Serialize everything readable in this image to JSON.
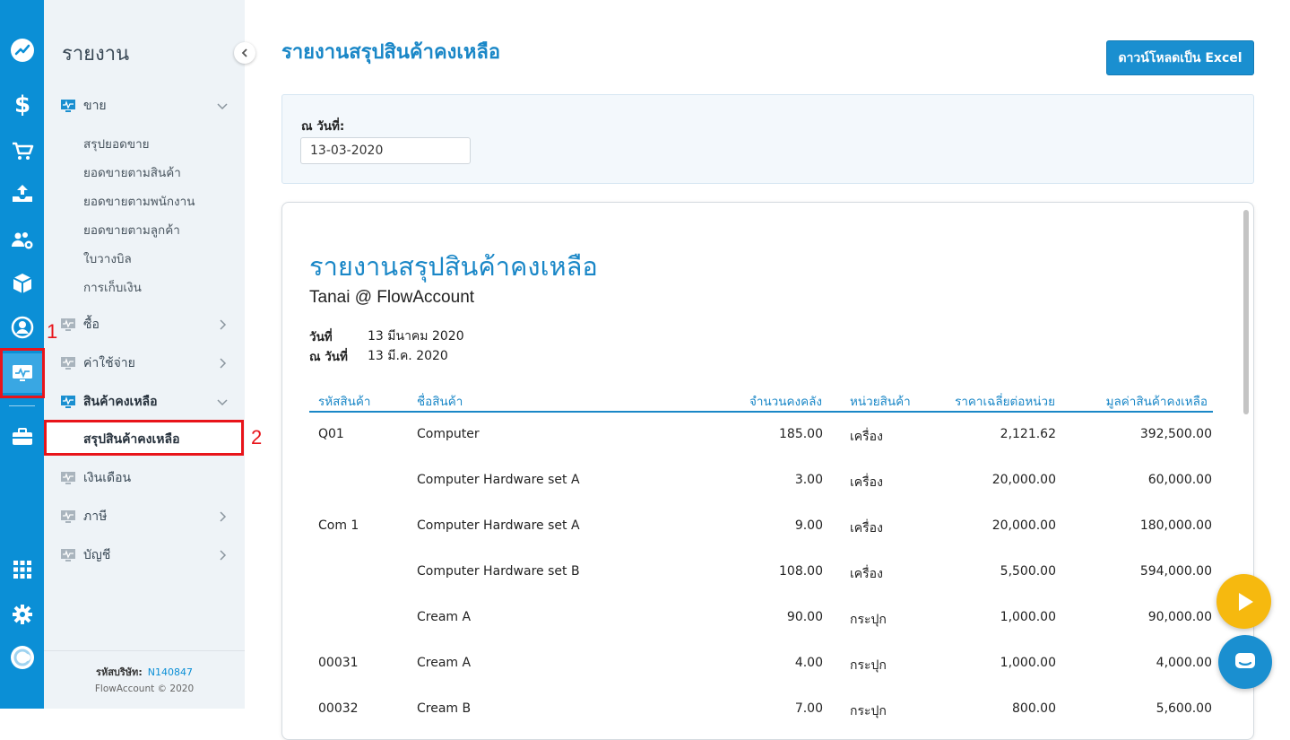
{
  "sidebar": {
    "title": "รายงาน",
    "sections": [
      {
        "label": "ขาย",
        "expanded": true,
        "items": [
          "สรุปยอดขาย",
          "ยอดขายตามสินค้า",
          "ยอดขายตามพนักงาน",
          "ยอดขายตามลูกค้า",
          "ใบวางบิล",
          "การเก็บเงิน"
        ]
      },
      {
        "label": "ซื้อ"
      },
      {
        "label": "ค่าใช้จ่าย"
      },
      {
        "label": "สินค้าคงเหลือ",
        "expanded": true,
        "items": [
          "สรุปสินค้าคงเหลือ"
        ]
      },
      {
        "label": "เงินเดือน"
      },
      {
        "label": "ภาษี"
      },
      {
        "label": "บัญชี"
      }
    ],
    "company_label": "รหัสบริษัท:",
    "company_id": "N140847",
    "copyright": "FlowAccount © 2020"
  },
  "annotations": {
    "one": "1",
    "two": "2"
  },
  "main": {
    "title": "รายงานสรุปสินค้าคงเหลือ",
    "download_button": "ดาวน์โหลดเป็น Excel",
    "filter_label": "ณ วันที่:",
    "date_value": "13-03-2020"
  },
  "report": {
    "title": "รายงานสรุปสินค้าคงเหลือ",
    "company": "Tanai @ FlowAccount",
    "date_label": "วันที่",
    "date_value": "13 มีนาคม 2020",
    "asof_label": "ณ วันที่",
    "asof_value": "13 มี.ค. 2020",
    "columns": [
      "รหัสสินค้า",
      "ชื่อสินค้า",
      "จำนวนคงคลัง",
      "หน่วยสินค้า",
      "ราคาเฉลี่ยต่อหน่วย",
      "มูลค่าสินค้าคงเหลือ"
    ],
    "rows": [
      [
        "Q01",
        "Computer",
        "185.00",
        "เครื่อง",
        "2,121.62",
        "392,500.00"
      ],
      [
        "",
        "Computer Hardware set A",
        "3.00",
        "เครื่อง",
        "20,000.00",
        "60,000.00"
      ],
      [
        "Com 1",
        "Computer Hardware set A",
        "9.00",
        "เครื่อง",
        "20,000.00",
        "180,000.00"
      ],
      [
        "",
        "Computer Hardware set B",
        "108.00",
        "เครื่อง",
        "5,500.00",
        "594,000.00"
      ],
      [
        "",
        "Cream A",
        "90.00",
        "กระปุก",
        "1,000.00",
        "90,000.00"
      ],
      [
        "00031",
        "Cream A",
        "4.00",
        "กระปุก",
        "1,000.00",
        "4,000.00"
      ],
      [
        "00032",
        "Cream B",
        "7.00",
        "กระปุก",
        "800.00",
        "5,600.00"
      ]
    ]
  },
  "colors": {
    "brand": "#0b8fd6",
    "accent": "#1a87c7",
    "annotation": "#e8141a",
    "play": "#f6b90f"
  },
  "icons": [
    "dashboard-icon",
    "dollar-icon",
    "cart-icon",
    "inbox-tray-icon",
    "contacts-icon",
    "box-icon",
    "user-circle-icon",
    "report-icon",
    "briefcase-icon",
    "apps-grid-icon",
    "settings-gear-icon",
    "profile-icon",
    "play-icon",
    "chat-icon"
  ]
}
